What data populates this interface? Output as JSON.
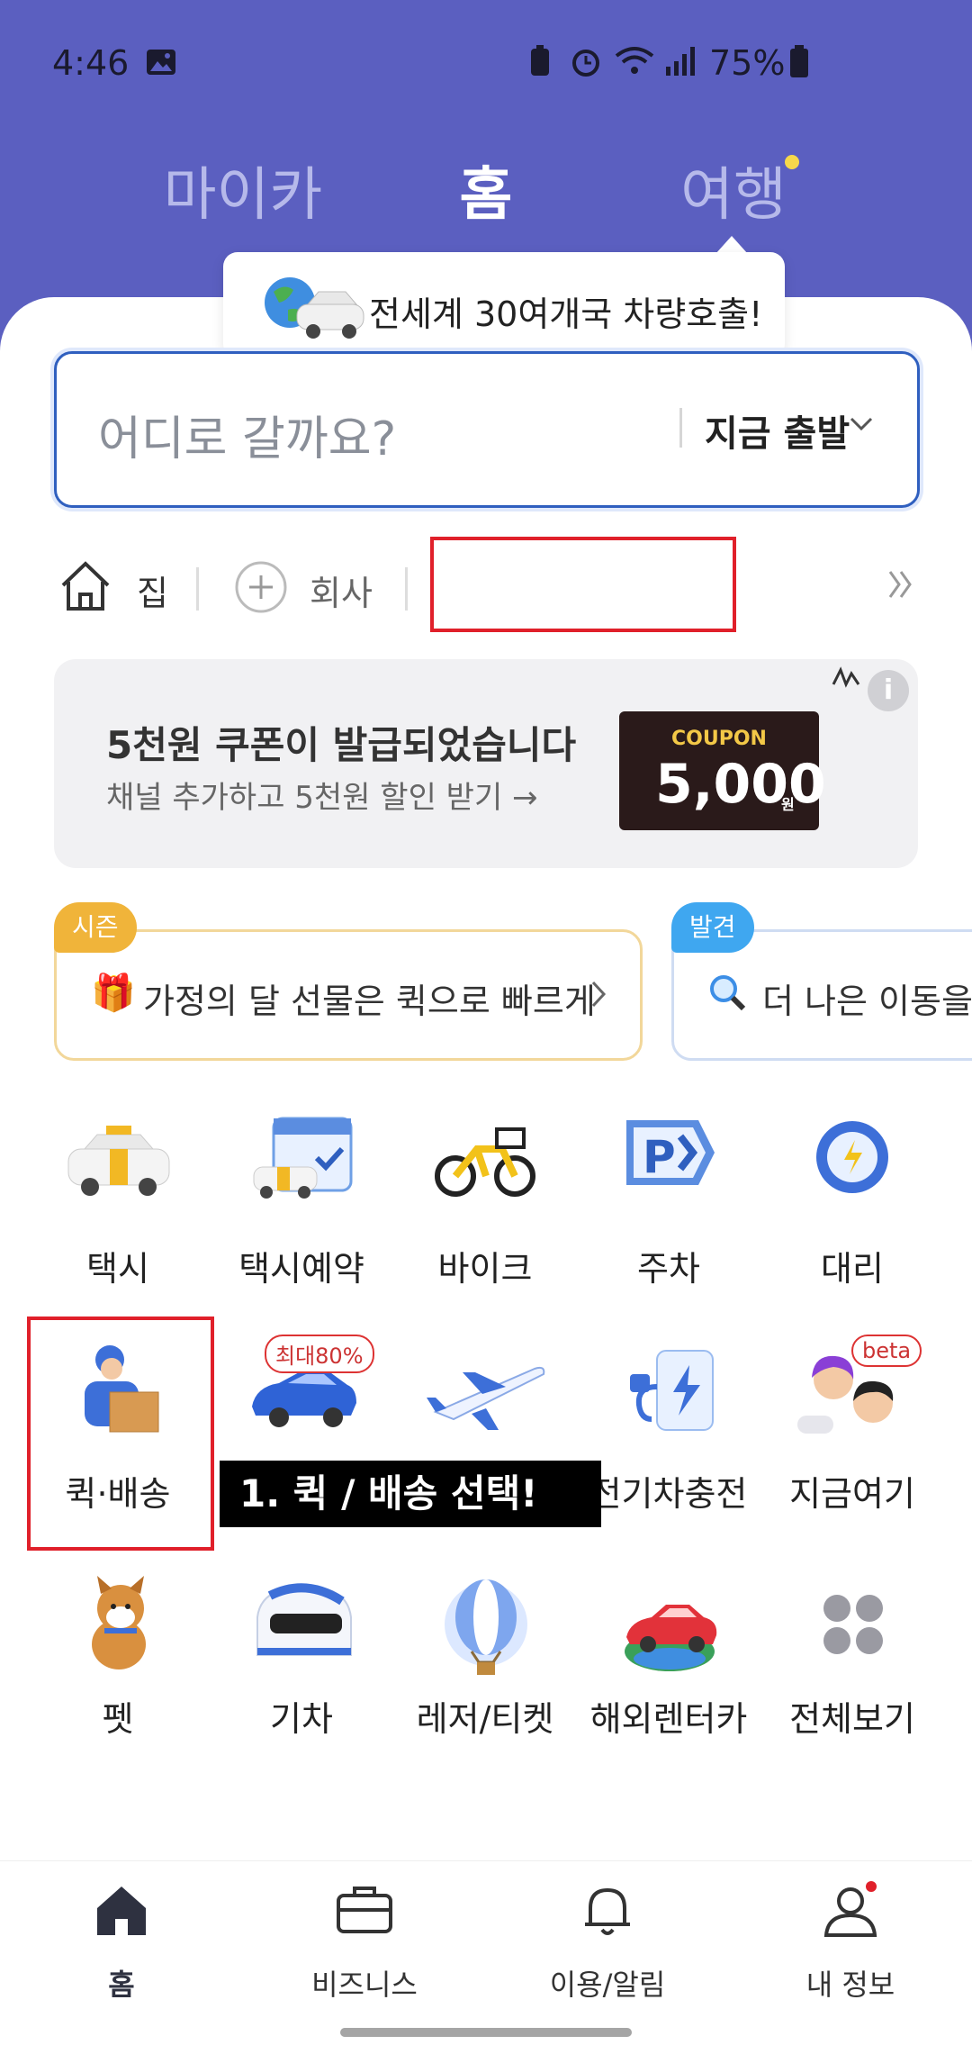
{
  "status_bar": {
    "time": "4:46",
    "battery": "75%"
  },
  "tabs": [
    {
      "label": "마이카"
    },
    {
      "label": "홈"
    },
    {
      "label": "여행"
    }
  ],
  "tooltip": {
    "text": "전세계 30여개국 차량호출!"
  },
  "search": {
    "placeholder": "어디로 갈까요?",
    "depart": "지금 출발"
  },
  "shortcuts": {
    "home": "집",
    "work": "회사"
  },
  "banner": {
    "title": "5천원 쿠폰이 발급되었습니다",
    "subtitle": "채널 추가하고 5천원 할인 받기 →",
    "coupon_label": "COUPON",
    "coupon_value": "5,000",
    "coupon_unit": "원"
  },
  "cards": {
    "season": {
      "tag": "시즌",
      "text": "가정의 달 선물은 퀵으로 빠르게"
    },
    "discover": {
      "tag": "발견",
      "text": "더 나은 이동을"
    }
  },
  "services": [
    {
      "label": "택시"
    },
    {
      "label": "택시예약"
    },
    {
      "label": "바이크"
    },
    {
      "label": "주차"
    },
    {
      "label": "대리"
    },
    {
      "label": "퀵·배송"
    },
    {
      "label": "",
      "badge": "최대80%"
    },
    {
      "label": ""
    },
    {
      "label": "전기차충전"
    },
    {
      "label": "지금여기",
      "badge": "beta"
    },
    {
      "label": "펫"
    },
    {
      "label": "기차"
    },
    {
      "label": "레저/티켓"
    },
    {
      "label": "해외렌터카"
    },
    {
      "label": "전체보기"
    }
  ],
  "callout": {
    "text": "1. 퀵 / 배송 선택!"
  },
  "bottom_nav": [
    {
      "label": "홈"
    },
    {
      "label": "비즈니스"
    },
    {
      "label": "이용/알림"
    },
    {
      "label": "내 정보"
    }
  ],
  "colors": {
    "brand": "#5b5fc0",
    "accent_blue": "#2f5fbf",
    "highlight_red": "#e0202a"
  }
}
